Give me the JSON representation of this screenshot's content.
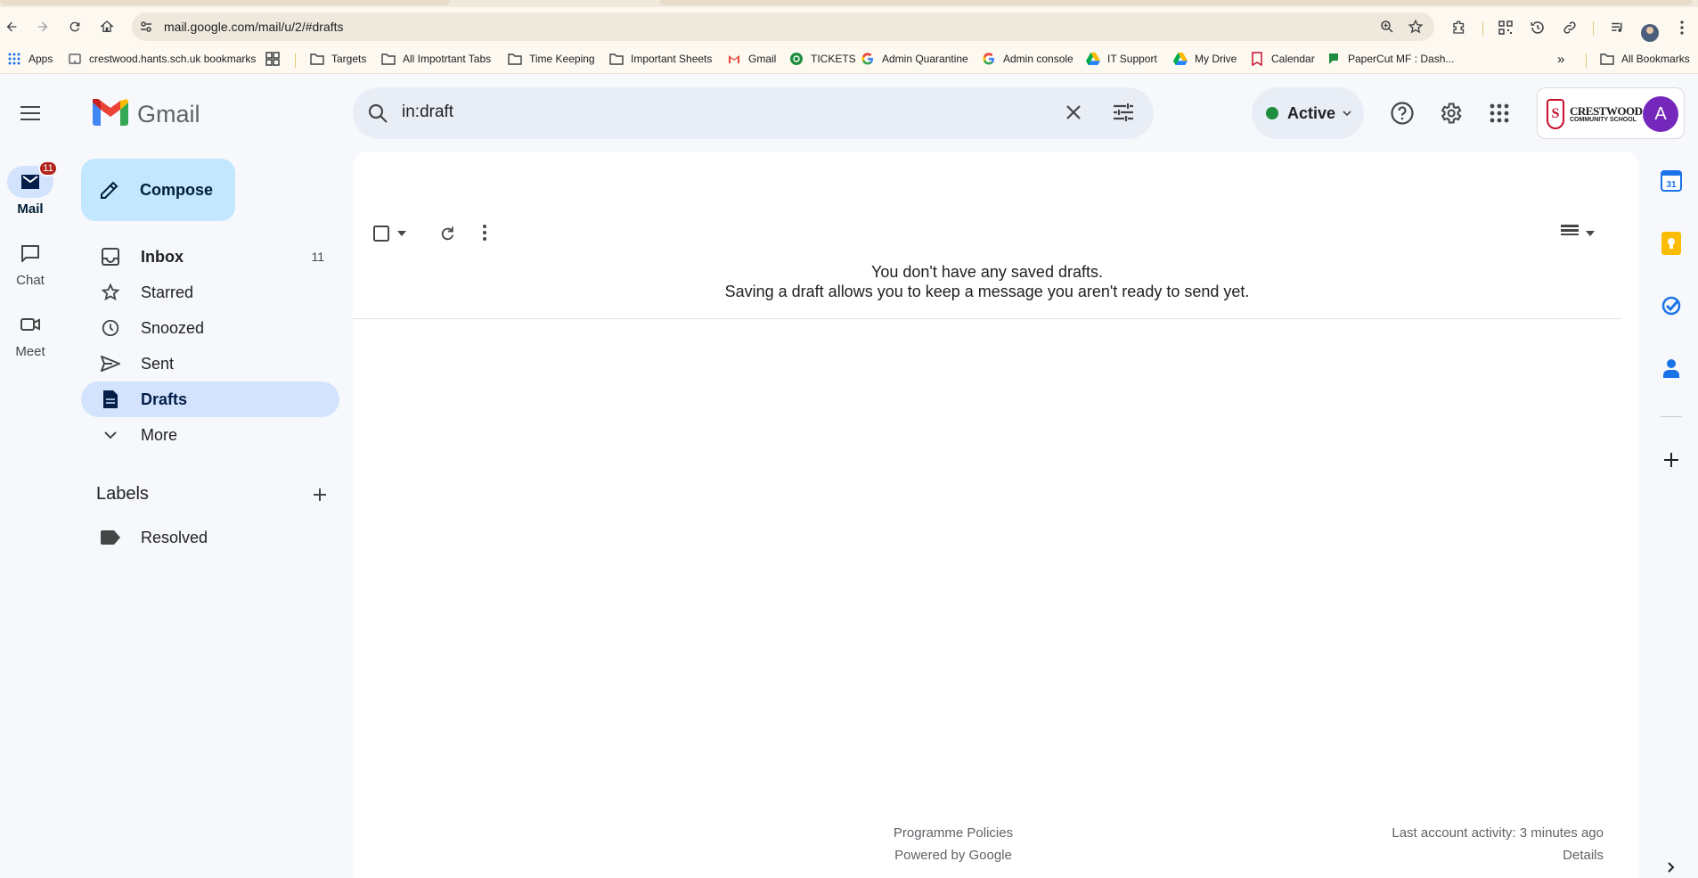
{
  "browser": {
    "url": "mail.google.com/mail/u/2/#drafts",
    "bookmarks": [
      {
        "label": "Apps",
        "icon": "apps-grid-icon"
      },
      {
        "label": "crestwood.hants.sch.uk bookmarks",
        "icon": "site-icon"
      },
      {
        "label": "Targets",
        "icon": "folder-icon"
      },
      {
        "label": "All Impotrtant Tabs",
        "icon": "folder-icon"
      },
      {
        "label": "Time Keeping",
        "icon": "folder-icon"
      },
      {
        "label": "Important Sheets",
        "icon": "folder-icon"
      },
      {
        "label": "Gmail",
        "icon": "gmail-icon"
      },
      {
        "label": "TICKETS",
        "icon": "ticket-icon"
      },
      {
        "label": "Admin Quarantine",
        "icon": "google-icon"
      },
      {
        "label": "Admin console",
        "icon": "google-icon"
      },
      {
        "label": "IT Support",
        "icon": "drive-icon"
      },
      {
        "label": "My Drive",
        "icon": "drive-icon"
      },
      {
        "label": "Calendar",
        "icon": "calendar-site-icon"
      },
      {
        "label": "PaperCut MF : Dash...",
        "icon": "papercut-icon"
      }
    ],
    "all_bookmarks": "All Bookmarks",
    "overflow": "»"
  },
  "app": {
    "name": "Gmail",
    "rail": {
      "mail": {
        "label": "Mail",
        "badge": "11"
      },
      "chat": {
        "label": "Chat"
      },
      "meet": {
        "label": "Meet"
      }
    }
  },
  "compose": {
    "label": "Compose"
  },
  "nav": {
    "items": [
      {
        "label": "Inbox",
        "count": "11",
        "icon": "inbox-icon"
      },
      {
        "label": "Starred",
        "count": "",
        "icon": "star-icon"
      },
      {
        "label": "Snoozed",
        "count": "",
        "icon": "clock-icon"
      },
      {
        "label": "Sent",
        "count": "",
        "icon": "send-icon"
      },
      {
        "label": "Drafts",
        "count": "",
        "icon": "draft-icon"
      },
      {
        "label": "More",
        "count": "",
        "icon": "chevron-down-icon"
      }
    ]
  },
  "labels": {
    "title": "Labels",
    "items": [
      {
        "label": "Resolved",
        "icon": "label-icon"
      }
    ]
  },
  "search": {
    "query": "in:draft"
  },
  "status": {
    "label": "Active",
    "color": "#1e8e3e"
  },
  "account": {
    "school_line1": "CRESTWOOD",
    "school_line2": "COMMUNITY SCHOOL",
    "school_initial": "S",
    "avatar_letter": "A",
    "avatar_color": "#7627bb"
  },
  "main": {
    "empty_title": "You don't have any saved drafts.",
    "empty_subtitle": "Saving a draft allows you to keep a message you aren't ready to send yet.",
    "footer": {
      "policies": "Programme Policies",
      "powered": "Powered by Google",
      "activity": "Last account activity: 3 minutes ago",
      "details": "Details"
    }
  },
  "colors": {
    "accent": "#0b57d0",
    "selected": "#d3e3fd",
    "compose": "#c2e7ff",
    "badge": "#b3261e"
  }
}
